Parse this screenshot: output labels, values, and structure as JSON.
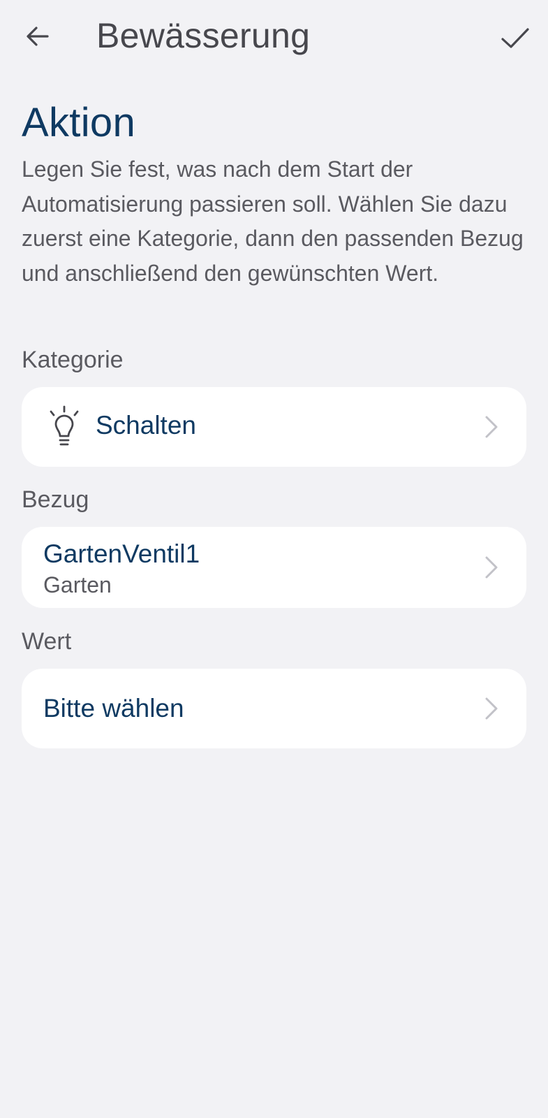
{
  "header": {
    "title": "Bewässerung",
    "back_icon": "arrow-left-icon",
    "confirm_icon": "checkmark-icon"
  },
  "section": {
    "title": "Aktion",
    "description": "Legen Sie fest, was nach dem Start der Automatisierung passieren soll. Wählen Sie dazu zuerst eine Kategorie, dann den passenden Bezug und anschließend den gewünschten Wert."
  },
  "kategorie": {
    "label": "Kategorie",
    "value": "Schalten",
    "icon": "lightbulb-icon"
  },
  "bezug": {
    "label": "Bezug",
    "value": "GartenVentil1",
    "subtitle": "Garten"
  },
  "wert": {
    "label": "Wert",
    "value": "Bitte wählen"
  },
  "colors": {
    "background": "#f2f2f5",
    "card": "#ffffff",
    "accent_text": "#0f3a62",
    "secondary_text": "#5a5a60",
    "chevron": "#c2c2c8"
  }
}
